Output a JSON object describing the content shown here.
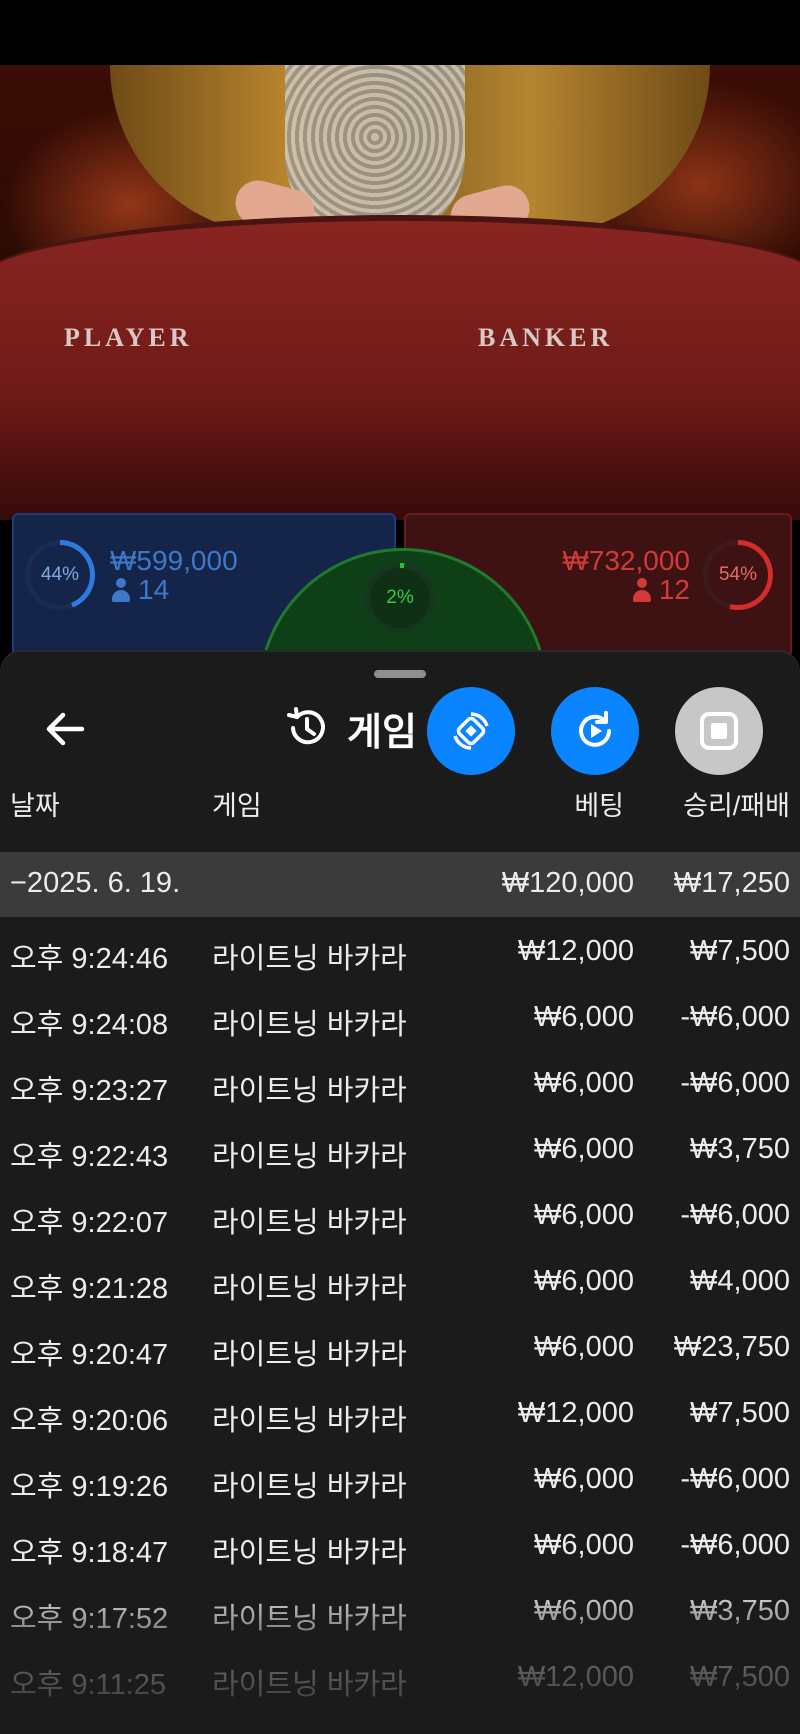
{
  "video": {
    "player_label": "PLAYER",
    "banker_label": "BANKER"
  },
  "bets": {
    "player": {
      "percent": "44%",
      "percent_value": 44,
      "amount": "₩599,000",
      "count": "14",
      "color": "#2d7be0"
    },
    "tie": {
      "percent": "2%",
      "percent_value": 2,
      "color": "#27c23a"
    },
    "banker": {
      "percent": "54%",
      "percent_value": 54,
      "amount": "₩732,000",
      "count": "12",
      "color": "#d42b2b"
    }
  },
  "sheet": {
    "title": "게임",
    "back_icon": "arrow-left-icon",
    "history_icon": "history-icon",
    "actions": [
      {
        "name": "rotate-screen-icon",
        "color": "#0a84ff"
      },
      {
        "name": "replay-icon",
        "color": "#0a84ff"
      },
      {
        "name": "stop-icon",
        "color": "#c7c7c7"
      }
    ]
  },
  "table": {
    "headers": {
      "date": "날짜",
      "game": "게임",
      "bet": "베팅",
      "result": "승리/패배"
    },
    "date_group": {
      "label": "−2025. 6. 19.",
      "bet": "₩120,000",
      "result": "₩17,250"
    },
    "rows": [
      {
        "time": "오후 9:24:46",
        "game": "라이트닝 바카라",
        "bet": "₩12,000",
        "result": "₩7,500"
      },
      {
        "time": "오후 9:24:08",
        "game": "라이트닝 바카라",
        "bet": "₩6,000",
        "result": "-₩6,000"
      },
      {
        "time": "오후 9:23:27",
        "game": "라이트닝 바카라",
        "bet": "₩6,000",
        "result": "-₩6,000"
      },
      {
        "time": "오후 9:22:43",
        "game": "라이트닝 바카라",
        "bet": "₩6,000",
        "result": "₩3,750"
      },
      {
        "time": "오후 9:22:07",
        "game": "라이트닝 바카라",
        "bet": "₩6,000",
        "result": "-₩6,000"
      },
      {
        "time": "오후 9:21:28",
        "game": "라이트닝 바카라",
        "bet": "₩6,000",
        "result": "₩4,000"
      },
      {
        "time": "오후 9:20:47",
        "game": "라이트닝 바카라",
        "bet": "₩6,000",
        "result": "₩23,750"
      },
      {
        "time": "오후 9:20:06",
        "game": "라이트닝 바카라",
        "bet": "₩12,000",
        "result": "₩7,500"
      },
      {
        "time": "오후 9:19:26",
        "game": "라이트닝 바카라",
        "bet": "₩6,000",
        "result": "-₩6,000"
      },
      {
        "time": "오후 9:18:47",
        "game": "라이트닝 바카라",
        "bet": "₩6,000",
        "result": "-₩6,000"
      },
      {
        "time": "오후 9:17:52",
        "game": "라이트닝 바카라",
        "bet": "₩6,000",
        "result": "₩3,750"
      },
      {
        "time": "오후 9:11:25",
        "game": "라이트닝 바카라",
        "bet": "₩12,000",
        "result": "₩7,500"
      }
    ]
  }
}
